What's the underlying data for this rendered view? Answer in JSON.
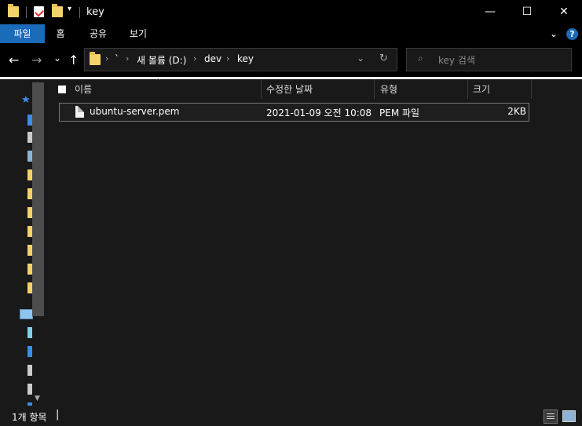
{
  "window": {
    "title": "key"
  },
  "window_controls": {
    "minimize": "—",
    "maximize": "☐",
    "close": "✕"
  },
  "ribbon": {
    "tabs": [
      {
        "label": "파일"
      },
      {
        "label": "홈"
      },
      {
        "label": "공유"
      },
      {
        "label": "보기"
      }
    ],
    "help": "?"
  },
  "nav": {
    "back": "←",
    "forward": "→",
    "recent": "⌄",
    "up": "↑"
  },
  "address": {
    "crumbs": [
      "`",
      "새 볼륨 (D:)",
      "dev",
      "key"
    ]
  },
  "search": {
    "placeholder": "key 검색"
  },
  "columns": [
    {
      "label": "이름"
    },
    {
      "label": "수정한 날짜"
    },
    {
      "label": "유형"
    },
    {
      "label": "크기"
    }
  ],
  "files": [
    {
      "name": "ubuntu-server.pem",
      "modified": "2021-01-09 오전 10:08",
      "type": "PEM 파일",
      "size": "2KB"
    }
  ],
  "status": {
    "count_text": "1개 항목"
  }
}
